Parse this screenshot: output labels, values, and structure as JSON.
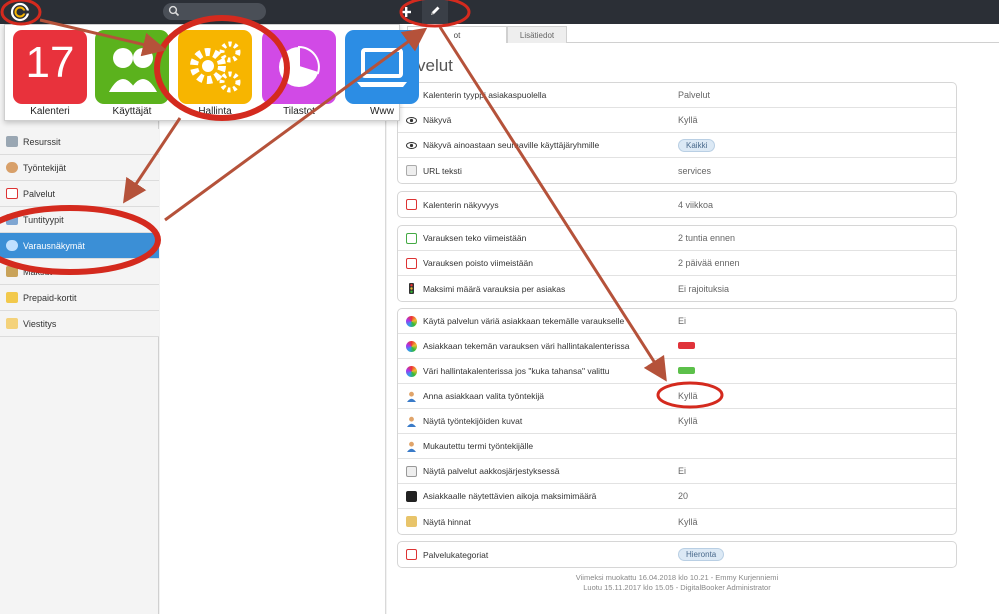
{
  "apps": [
    {
      "label": "Kalenteri",
      "day": "17",
      "icon": "calendar-icon",
      "color": "#e8323c"
    },
    {
      "label": "Käyttäjät",
      "icon": "users-icon",
      "color": "#5bb21d"
    },
    {
      "label": "Hallinta",
      "icon": "gears-icon",
      "color": "#f7b500"
    },
    {
      "label": "Tilastot",
      "icon": "pie-chart-icon",
      "color": "#d14ae6"
    },
    {
      "label": "Www",
      "icon": "laptop-icon",
      "color": "#2c8de4"
    }
  ],
  "sidebar": {
    "items": [
      {
        "label": "Resurssit",
        "icon": "resources-icon"
      },
      {
        "label": "Työntekijät",
        "icon": "employees-icon"
      },
      {
        "label": "Palvelut",
        "icon": "services-icon"
      },
      {
        "label": "Tuntityypit",
        "icon": "hour-types-icon"
      },
      {
        "label": "Varausnäkymät",
        "icon": "booking-views-icon",
        "active": true
      },
      {
        "label": "Maksut",
        "icon": "payments-icon"
      },
      {
        "label": "Prepaid-kortit",
        "icon": "prepaid-card-icon"
      },
      {
        "label": "Viestitys",
        "icon": "messaging-icon"
      }
    ]
  },
  "tabs": [
    {
      "label": "ot"
    },
    {
      "label": "Lisätiedot"
    }
  ],
  "page_title": "velut",
  "settings": {
    "group1": [
      {
        "label": "Kalenterin tyyppi asiakaspuolella",
        "value": "Palvelut",
        "icon": "calendar-icon"
      },
      {
        "label": "Näkyvä",
        "value": "Kyllä",
        "icon": "eye-icon"
      },
      {
        "label": "Näkyvä ainoastaan seuraaville käyttäjäryhmille",
        "pill": "Kaikki",
        "icon": "eye-icon"
      },
      {
        "label": "URL teksti",
        "value": "services",
        "icon": "url-icon"
      }
    ],
    "group2": [
      {
        "label": "Kalenterin näkyvyys",
        "value": "4 viikkoa",
        "icon": "calendar-icon"
      }
    ],
    "group3": [
      {
        "label": "Varauksen teko viimeistään",
        "value": "2 tuntia ennen",
        "icon": "calendar-add-icon"
      },
      {
        "label": "Varauksen poisto viimeistään",
        "value": "2 päivää ennen",
        "icon": "calendar-remove-icon"
      },
      {
        "label": "Maksimi määrä varauksia per asiakas",
        "value": "Ei rajoituksia",
        "icon": "traffic-light-icon"
      }
    ],
    "group4": [
      {
        "label": "Käytä palvelun väriä asiakkaan tekemälle varaukselle",
        "value": "Ei",
        "icon": "color-wheel-icon"
      },
      {
        "label": "Asiakkaan tekemän varauksen väri hallintakalenterissa",
        "swatch": "#e0333a",
        "icon": "color-wheel-icon"
      },
      {
        "label": "Väri hallintakalenterissa jos \"kuka tahansa\" valittu",
        "swatch": "#5cc04a",
        "icon": "color-wheel-icon"
      },
      {
        "label": "Anna asiakkaan valita työntekijä",
        "value": "Kyllä",
        "icon": "person-icon"
      },
      {
        "label": "Näytä työntekijöiden kuvat",
        "value": "Kyllä",
        "icon": "person-icon"
      },
      {
        "label": "Mukautettu termi työntekijälle",
        "value": "",
        "icon": "person-icon"
      },
      {
        "label": "Näytä palvelut aakkosjärjestyksessä",
        "value": "Ei",
        "icon": "sort-icon"
      },
      {
        "label": "Asiakkaalle näytettävien aikoja maksimimäärä",
        "value": "20",
        "icon": "counter-icon"
      },
      {
        "label": "Näytä hinnat",
        "value": "Kyllä",
        "icon": "price-icon"
      }
    ],
    "group5": [
      {
        "label": "Palvelukategoriat",
        "pill": "Hieronta",
        "icon": "calendar-icon"
      }
    ]
  },
  "footer": {
    "modified": "Viimeksi muokattu 16.04.2018 klo 10.21 - Emmy Kurjenniemi",
    "created": "Luotu 15.11.2017 klo 15.05 - DigitalBooker Administrator"
  },
  "colors": {
    "topbar": "#2b2f36",
    "accent_blue": "#3b8fd6",
    "annotation_red": "#d42a1e",
    "arrow_brown": "#b5523a"
  }
}
